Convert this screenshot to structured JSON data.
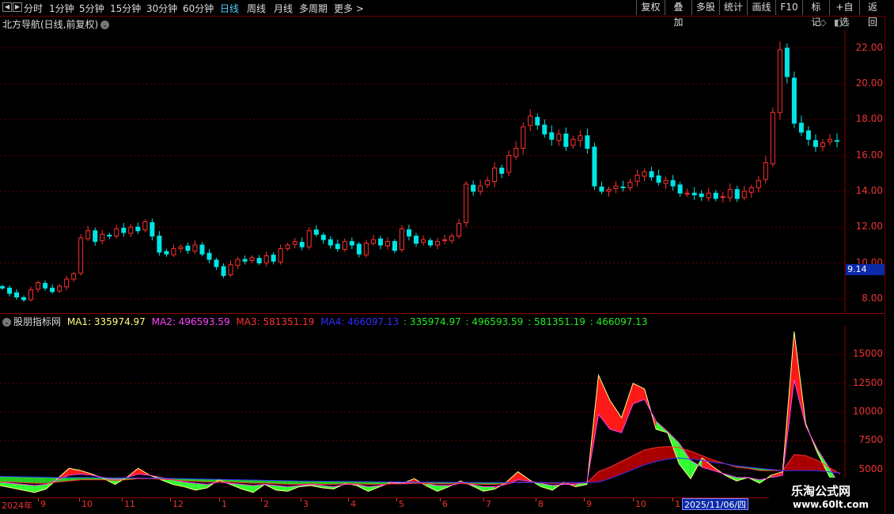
{
  "toolbar": {
    "periods": [
      "分时",
      "1分钟",
      "5分钟",
      "15分钟",
      "30分钟",
      "60分钟",
      "日线",
      "周线",
      "月线",
      "多周期",
      "更多 >"
    ],
    "active_period": "日线",
    "right_buttons": [
      "复权",
      "叠加",
      "多股",
      "统计",
      "画线",
      "F10",
      "标记",
      "+自选",
      "返回"
    ]
  },
  "main_chart": {
    "title": "北方导航(日线,前复权)",
    "price_tag": "9.14"
  },
  "indicator": {
    "name": "股朋指标网",
    "ma1_label": "MA1: 335974.97",
    "ma2_label": "MA2: 496593.59",
    "ma3_label": "MA3: 581351.19",
    "ma4_label": "MA4: 466097.13",
    "extra1": ": 335974.97",
    "extra2": ": 496593.59",
    "extra3": ": 581351.19",
    "extra4": ": 466097.13"
  },
  "x_axis": {
    "labels": [
      "2024年",
      "9",
      "10",
      "11",
      "12",
      "1",
      "2",
      "3",
      "4",
      "5",
      "6",
      "7",
      "8",
      "9",
      "10",
      "1"
    ],
    "cursor_date": "2025/11/06/四"
  },
  "watermark": {
    "line1": "乐淘公式网",
    "line2": "www.60lt.com"
  },
  "colors": {
    "up": "#ff3030",
    "down": "#00e5e5",
    "ma1": "#ffff80",
    "ma2": "#ff40ff",
    "ma3": "#ff3030",
    "ma4": "#3030ff",
    "green": "#22ee22"
  },
  "chart_data": [
    {
      "type": "candlestick",
      "title": "北方导航(日线,前复权)",
      "y_ticks": [
        "22.00",
        "20.00",
        "18.00",
        "16.00",
        "14.00",
        "12.00",
        "10.00",
        "8.00"
      ],
      "ylim": [
        7.2,
        23.0
      ],
      "close_series": [
        8.6,
        8.3,
        8.1,
        7.95,
        8.5,
        8.9,
        8.6,
        8.4,
        8.7,
        9.1,
        9.4,
        11.4,
        11.8,
        11.2,
        11.6,
        11.5,
        11.9,
        11.7,
        12.0,
        11.8,
        12.3,
        11.5,
        10.6,
        10.5,
        10.8,
        10.9,
        10.7,
        11.0,
        10.5,
        10.2,
        9.8,
        9.3,
        9.9,
        10.2,
        10.1,
        10.3,
        10.0,
        10.4,
        10.1,
        10.8,
        11.0,
        11.2,
        10.9,
        11.8,
        11.6,
        11.3,
        11.0,
        10.8,
        11.2,
        11.0,
        10.5,
        11.1,
        11.3,
        11.0,
        11.2,
        10.7,
        11.9,
        11.5,
        11.1,
        11.3,
        11.0,
        11.2,
        11.3,
        11.5,
        12.2,
        14.4,
        14.0,
        14.3,
        14.6,
        15.3,
        15.0,
        16.0,
        16.4,
        17.6,
        18.2,
        17.7,
        17.2,
        16.9,
        17.2,
        16.5,
        16.9,
        17.1,
        16.4,
        14.3,
        14.0,
        14.1,
        14.3,
        14.2,
        14.5,
        14.9,
        15.1,
        14.8,
        14.5,
        14.6,
        14.3,
        13.9,
        13.9,
        13.8,
        13.7,
        13.9,
        13.6,
        13.7,
        14.1,
        13.6,
        14.0,
        14.2,
        14.6,
        15.6,
        18.4,
        21.9,
        20.4,
        17.8,
        17.3,
        16.9,
        16.5,
        16.7,
        16.9,
        16.8
      ],
      "x_ticks": [
        "2024年",
        "9",
        "10",
        "11",
        "12",
        "1",
        "2",
        "3",
        "4",
        "5",
        "6",
        "7",
        "8",
        "9",
        "10",
        "1"
      ],
      "last_price_tag": "9.14"
    },
    {
      "type": "area",
      "title": "股朋指标网",
      "y_ticks": [
        "15000",
        "12500",
        "10000",
        "7500",
        "5000"
      ],
      "ylim": [
        2500,
        17500
      ],
      "series": [
        {
          "name": "MA1: 335974.97",
          "values": [
            3600,
            3400,
            3200,
            3000,
            3300,
            4200,
            5100,
            4900,
            4600,
            4200,
            3700,
            4300,
            5100,
            4500,
            4100,
            3700,
            3500,
            3200,
            3400,
            4100,
            3700,
            3300,
            3000,
            3700,
            3200,
            3100,
            3500,
            3600,
            3400,
            3300,
            3800,
            3600,
            3100,
            3500,
            3900,
            3800,
            4200,
            3600,
            3100,
            3500,
            4000,
            3600,
            3100,
            3300,
            3900,
            4800,
            4100,
            3500,
            3200,
            3900,
            3500,
            3700,
            13200,
            11000,
            9500,
            12500,
            12000,
            8500,
            8200,
            5500,
            4200,
            6000,
            5200,
            4500,
            4000,
            4300,
            3800,
            4500,
            4800,
            17000,
            9000,
            6500,
            4500,
            3000
          ]
        },
        {
          "name": "MA2: 496593.59",
          "values": [
            3900,
            3800,
            3700,
            3600,
            3700,
            4100,
            4500,
            4600,
            4500,
            4300,
            4100,
            4300,
            4600,
            4500,
            4300,
            4100,
            3900,
            3800,
            3700,
            3900,
            3800,
            3700,
            3600,
            3700,
            3600,
            3500,
            3600,
            3700,
            3600,
            3500,
            3700,
            3700,
            3500,
            3600,
            3800,
            3800,
            3900,
            3800,
            3600,
            3600,
            3800,
            3700,
            3500,
            3500,
            3700,
            4100,
            4000,
            3800,
            3600,
            3700,
            3700,
            3900,
            9800,
            8500,
            8200,
            10700,
            11100,
            9200,
            8300,
            7300,
            5800,
            5200,
            4900,
            4600,
            4300,
            4300,
            4100,
            4300,
            4500,
            12800,
            8800,
            6800,
            5200,
            3600
          ]
        },
        {
          "name": "MA3: 581351.19",
          "values": [
            3900,
            3900,
            3850,
            3800,
            3800,
            3900,
            4000,
            4100,
            4100,
            4100,
            4050,
            4100,
            4200,
            4200,
            4150,
            4100,
            4000,
            3950,
            3900,
            3900,
            3900,
            3850,
            3800,
            3800,
            3750,
            3700,
            3700,
            3750,
            3700,
            3700,
            3750,
            3750,
            3700,
            3700,
            3750,
            3750,
            3800,
            3800,
            3750,
            3750,
            3800,
            3750,
            3700,
            3700,
            3750,
            3900,
            3900,
            3850,
            3800,
            3800,
            3800,
            3850,
            4800,
            5200,
            5700,
            6200,
            6700,
            6900,
            7000,
            6900,
            6600,
            6200,
            5800,
            5500,
            5200,
            5100,
            4900,
            4900,
            4900,
            6300,
            6200,
            5800,
            5200,
            4600
          ]
        },
        {
          "name": "MA4: 466097.13",
          "values": [
            4400,
            4380,
            4360,
            4340,
            4320,
            4300,
            4300,
            4310,
            4300,
            4290,
            4270,
            4260,
            4260,
            4250,
            4240,
            4220,
            4200,
            4180,
            4160,
            4140,
            4120,
            4100,
            4080,
            4060,
            4040,
            4020,
            4000,
            3990,
            3980,
            3970,
            3960,
            3950,
            3940,
            3930,
            3920,
            3910,
            3900,
            3895,
            3890,
            3885,
            3880,
            3875,
            3870,
            3865,
            3860,
            3860,
            3860,
            3860,
            3860,
            3860,
            3860,
            3860,
            3900,
            4200,
            4600,
            5000,
            5400,
            5700,
            5900,
            6000,
            5900,
            5800,
            5600,
            5500,
            5300,
            5200,
            5100,
            5000,
            4900,
            4900,
            4900,
            4900,
            4800,
            4700
          ]
        }
      ]
    }
  ]
}
